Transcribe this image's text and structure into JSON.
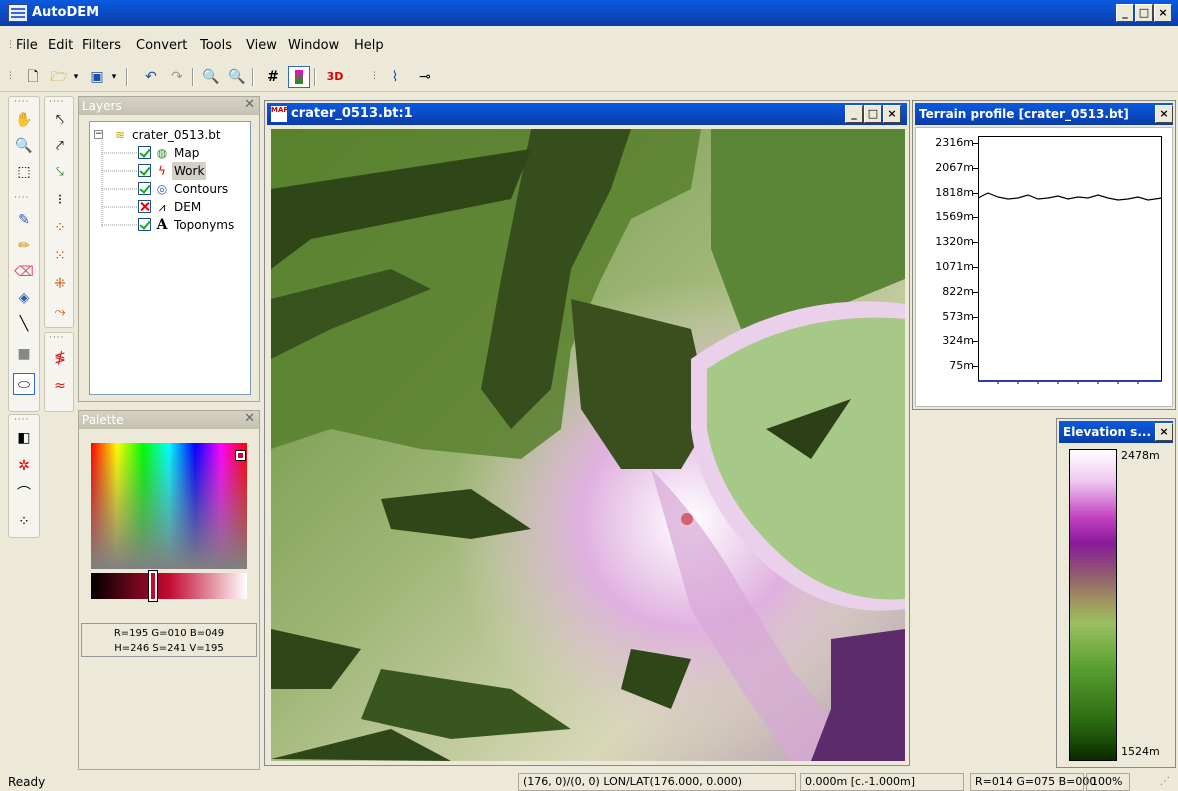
{
  "app": {
    "title": "AutoDEM"
  },
  "window_buttons": [
    "_",
    "□",
    "×"
  ],
  "menu": [
    "File",
    "Edit",
    "Filters",
    "Convert",
    "Tools",
    "View",
    "Window",
    "Help"
  ],
  "toolbar": {
    "btn_3d": "3D"
  },
  "layers_panel": {
    "title": "Layers",
    "root": "crater_0513.bt",
    "items": [
      {
        "label": "Map",
        "checked": true
      },
      {
        "label": "Work",
        "checked": true,
        "selected": true
      },
      {
        "label": "Contours",
        "checked": true
      },
      {
        "label": "DEM",
        "checked": false
      },
      {
        "label": "Toponyms",
        "checked": true
      }
    ]
  },
  "palette_panel": {
    "title": "Palette",
    "rgb": "R=195 G=010 B=049",
    "hsv": "H=246 S=241 V=195"
  },
  "map_window": {
    "title": "crater_0513.bt:1"
  },
  "profile_window": {
    "title": "Terrain profile [crater_0513.bt]",
    "y_labels": [
      "2316m",
      "2067m",
      "1818m",
      "1569m",
      "1320m",
      "1071m",
      "822m",
      "573m",
      "324m",
      "75m"
    ]
  },
  "elevation_window": {
    "title": "Elevation s...",
    "max": "2478m",
    "min": "1524m"
  },
  "status": {
    "state": "Ready",
    "coords": "(176, 0)/(0, 0) LON/LAT(176.000, 0.000)",
    "elevation": "0.000m [c.-1.000m]",
    "color": "R=014 G=075 B=000",
    "zoom": "100%"
  },
  "colors": {
    "titlebar": "#0a4fd0",
    "selection": "#316ac5"
  }
}
